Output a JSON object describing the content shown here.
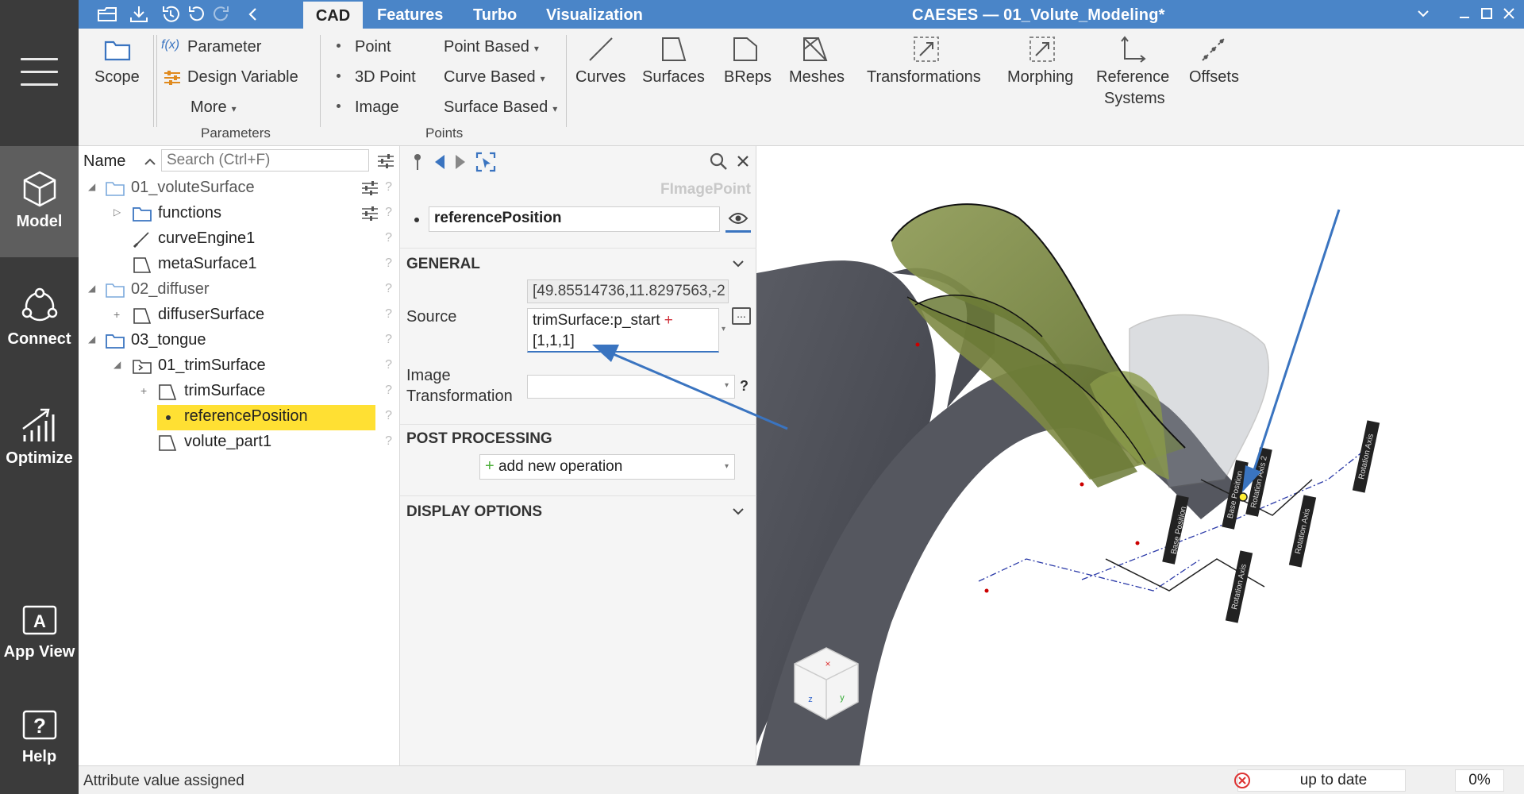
{
  "rail": {
    "model": "Model",
    "connect": "Connect",
    "optimize": "Optimize",
    "app_view": "App View",
    "help": "Help"
  },
  "titlebar": {
    "tabs": [
      "CAD",
      "Features",
      "Turbo",
      "Visualization"
    ],
    "title": "CAESES — 01_Volute_Modeling*"
  },
  "ribbon": {
    "scope": "Scope",
    "parameter": "Parameter",
    "parameter_icon": "f(x)",
    "design_variable": "Design Variable",
    "more": "More",
    "group_parameters": "Parameters",
    "point": "Point",
    "point_3d": "3D Point",
    "image": "Image",
    "point_based": "Point Based",
    "curve_based": "Curve Based",
    "surface_based": "Surface Based",
    "group_points": "Points",
    "curves": "Curves",
    "surfaces": "Surfaces",
    "breps": "BReps",
    "meshes": "Meshes",
    "transformations": "Transformations",
    "morphing": "Morphing",
    "reference_systems_1": "Reference",
    "reference_systems_2": "Systems",
    "offsets": "Offsets"
  },
  "tree": {
    "header_name": "Name",
    "search_placeholder": "Search (Ctrl+F)",
    "items": [
      "01_voluteSurface",
      "functions",
      "curveEngine1",
      "metaSurface1",
      "02_diffuser",
      "diffuserSurface",
      "03_tongue",
      "01_trimSurface",
      "trimSurface",
      "referencePosition",
      "volute_part1"
    ],
    "q": "?"
  },
  "props": {
    "type_label": "FImagePoint",
    "name_value": "referencePosition",
    "general": "GENERAL",
    "source_label": "Source",
    "source_result": "[49.85514736,11.8297563,-2",
    "source_expr_1": "trimSurface:p_start",
    "source_expr_plus": "+",
    "source_expr_2": "[1,1,1]",
    "image_transformation_1": "Image",
    "image_transformation_2": "Transformation",
    "post_processing": "POST PROCESSING",
    "add_operation": "add new operation",
    "display_options": "DISPLAY OPTIONS",
    "q": "?",
    "dots": "..."
  },
  "viewport": {
    "labels": [
      "Base Position",
      "Rotation Axis",
      "Base Position",
      "Rotation Axis 2",
      "Rotation Axis",
      "Rotation Axis"
    ]
  },
  "status": {
    "message": "Attribute value assigned",
    "state": "up to date",
    "progress": "0%"
  },
  "colors": {
    "accent": "#4a85c8",
    "highlight": "#ffe033",
    "rail": "#3b3b3b"
  }
}
